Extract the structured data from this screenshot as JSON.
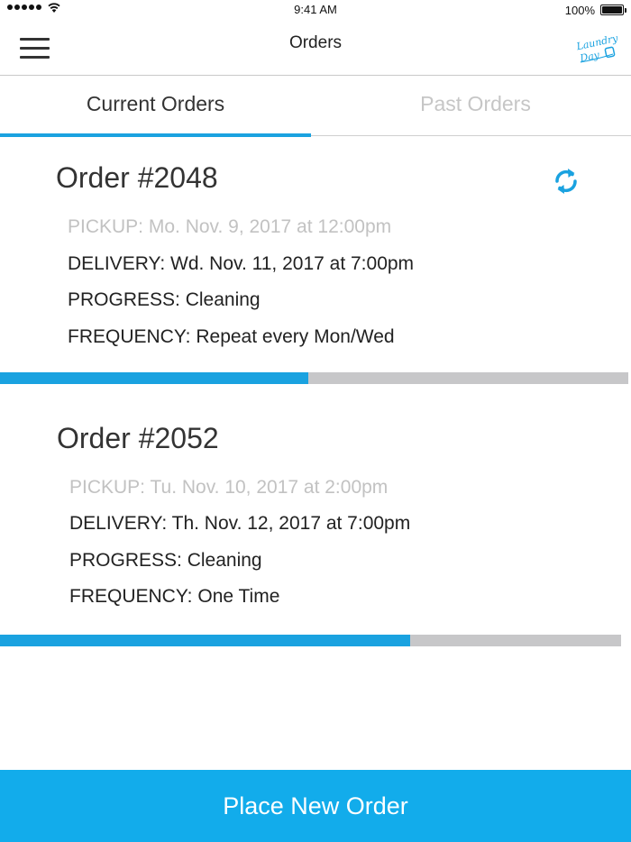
{
  "status_bar": {
    "time": "9:41 AM",
    "battery": "100%",
    "icons": [
      "signal-icon",
      "wifi-icon",
      "battery-icon"
    ]
  },
  "nav": {
    "title": "Orders",
    "menu_icon": "hamburger-menu-icon",
    "logo_line1": "Laundry",
    "logo_line2": "Day"
  },
  "tabs": [
    {
      "label": "Current Orders",
      "active": true
    },
    {
      "label": "Past Orders",
      "active": false
    }
  ],
  "orders": [
    {
      "title": "Order #2048",
      "pickup": "PICKUP: Mo. Nov. 9, 2017 at 12:00pm",
      "delivery": "DELIVERY: Wd. Nov. 11, 2017 at 7:00pm",
      "progress": "PROGRESS: Cleaning",
      "frequency": "FREQUENCY: Repeat every Mon/Wed",
      "progress_fraction": 0.49,
      "has_refresh": true
    },
    {
      "title": "Order #2052",
      "pickup": "PICKUP: Tu. Nov. 10, 2017 at 2:00pm",
      "delivery": "DELIVERY: Th. Nov. 12, 2017 at 7:00pm",
      "progress": "PROGRESS: Cleaning",
      "frequency": "FREQUENCY: One Time",
      "progress_fraction": 0.66,
      "has_refresh": false
    }
  ],
  "actions": {
    "place_order": "Place New Order"
  },
  "colors": {
    "accent": "#1aa2e0",
    "button": "#12aceb",
    "track": "#c7c7c9",
    "muted_text": "#c2c2c2"
  }
}
